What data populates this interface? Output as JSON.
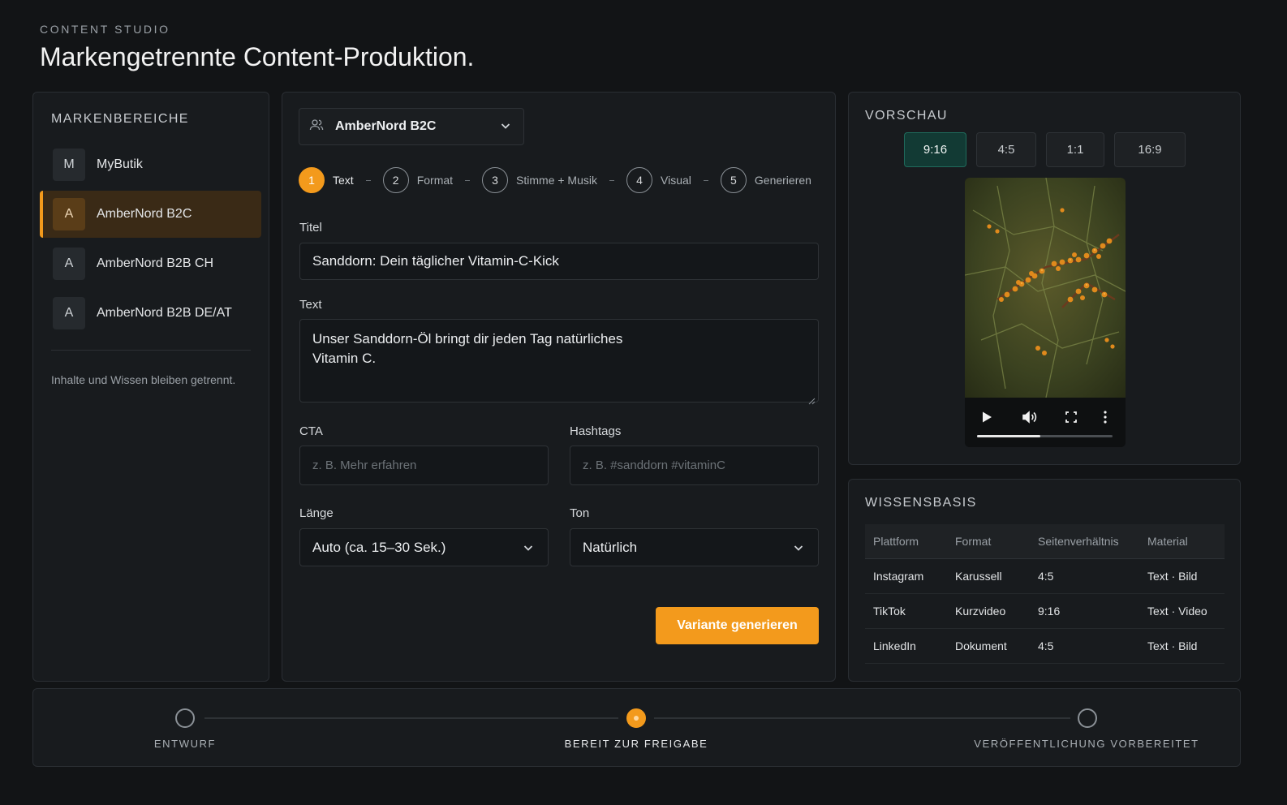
{
  "header": {
    "eyebrow": "CONTENT STUDIO",
    "title": "Markengetrennte Content-Produktion."
  },
  "sidebar": {
    "title": "MARKENBEREICHE",
    "items": [
      {
        "initial": "M",
        "label": "MyButik",
        "active": false
      },
      {
        "initial": "A",
        "label": "AmberNord B2C",
        "active": true
      },
      {
        "initial": "A",
        "label": "AmberNord B2B CH",
        "active": false
      },
      {
        "initial": "A",
        "label": "AmberNord B2B DE/AT",
        "active": false
      }
    ],
    "note": "Inhalte und Wissen bleiben getrennt."
  },
  "editor": {
    "brand_select": {
      "icon": "users-icon",
      "value": "AmberNord B2C"
    },
    "steps": [
      {
        "num": "1",
        "label": "Text",
        "active": true
      },
      {
        "num": "2",
        "label": "Format",
        "active": false
      },
      {
        "num": "3",
        "label": "Stimme + Musik",
        "active": false
      },
      {
        "num": "4",
        "label": "Visual",
        "active": false
      },
      {
        "num": "5",
        "label": "Generieren",
        "active": false
      }
    ],
    "title_label": "Titel",
    "title_value": "Sanddorn: Dein täglicher Vitamin-C-Kick",
    "text_label": "Text",
    "text_value": "Unser Sanddorn-Öl bringt dir jeden Tag natürliches Vitamin C.",
    "cta_label": "CTA",
    "cta_placeholder": "z. B. Mehr erfahren",
    "hashtags_label": "Hashtags",
    "hashtags_placeholder": "z. B. #sanddorn #vitaminC",
    "length_label": "Länge",
    "length_value": "Auto (ca. 15–30 Sek.)",
    "tone_label": "Ton",
    "tone_value": "Natürlich",
    "generate_label": "Variante generieren"
  },
  "preview": {
    "title": "VORSCHAU",
    "ratios": [
      {
        "label": "9:16",
        "active": true
      },
      {
        "label": "4:5",
        "active": false
      },
      {
        "label": "1:1",
        "active": false
      },
      {
        "label": "16:9",
        "active": false
      }
    ],
    "video_progress": 0.47
  },
  "knowledge": {
    "title": "WISSENSBASIS",
    "columns": [
      "Plattform",
      "Format",
      "Seitenverhältnis",
      "Material"
    ],
    "rows": [
      [
        "Instagram",
        "Karussell",
        "4:5",
        "Text · Bild"
      ],
      [
        "TikTok",
        "Kurzvideo",
        "9:16",
        "Text · Video"
      ],
      [
        "LinkedIn",
        "Dokument",
        "4:5",
        "Text · Bild"
      ]
    ]
  },
  "status": {
    "steps": [
      {
        "label": "ENTWURF",
        "active": false
      },
      {
        "label": "BEREIT ZUR FREIGABE",
        "active": true
      },
      {
        "label": "VERÖFFENTLICHUNG VORBEREITET",
        "active": false
      }
    ]
  },
  "colors": {
    "accent": "#f39a1c",
    "active_ratio": "#123a34",
    "background": "#121416",
    "panel": "#181b1e"
  }
}
